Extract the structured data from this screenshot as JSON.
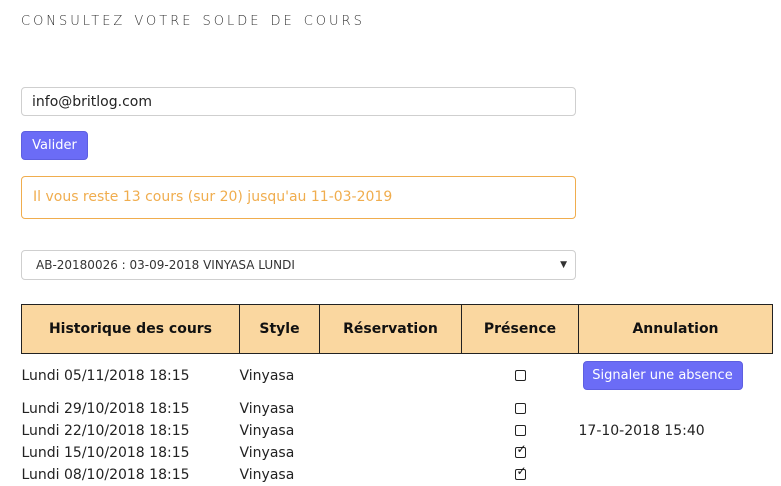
{
  "page": {
    "title": "Consultez votre solde de cours"
  },
  "form": {
    "email_value": "info@britlog.com",
    "validate_label": "Valider"
  },
  "alert": {
    "text": "Il vous reste 13 cours (sur 20) jusqu'au 11-03-2019"
  },
  "subscription_select": {
    "selected": "AB-20180026 : 03-09-2018 VINYASA LUNDI"
  },
  "history": {
    "headers": [
      "Historique des cours",
      "Style",
      "Réservation",
      "Présence",
      "Annulation"
    ],
    "absence_button_label": "Signaler une absence",
    "rows": [
      {
        "date": "Lundi 05/11/2018 18:15",
        "style": "Vinyasa",
        "reservation": "",
        "presence": false,
        "annulation": "",
        "has_absence_button": true
      },
      {
        "date": "Lundi 29/10/2018 18:15",
        "style": "Vinyasa",
        "reservation": "",
        "presence": false,
        "annulation": ""
      },
      {
        "date": "Lundi 22/10/2018 18:15",
        "style": "Vinyasa",
        "reservation": "",
        "presence": false,
        "annulation": "17-10-2018 15:40"
      },
      {
        "date": "Lundi 15/10/2018 18:15",
        "style": "Vinyasa",
        "reservation": "",
        "presence": true,
        "annulation": ""
      },
      {
        "date": "Lundi 08/10/2018 18:15",
        "style": "Vinyasa",
        "reservation": "",
        "presence": true,
        "annulation": ""
      }
    ]
  }
}
